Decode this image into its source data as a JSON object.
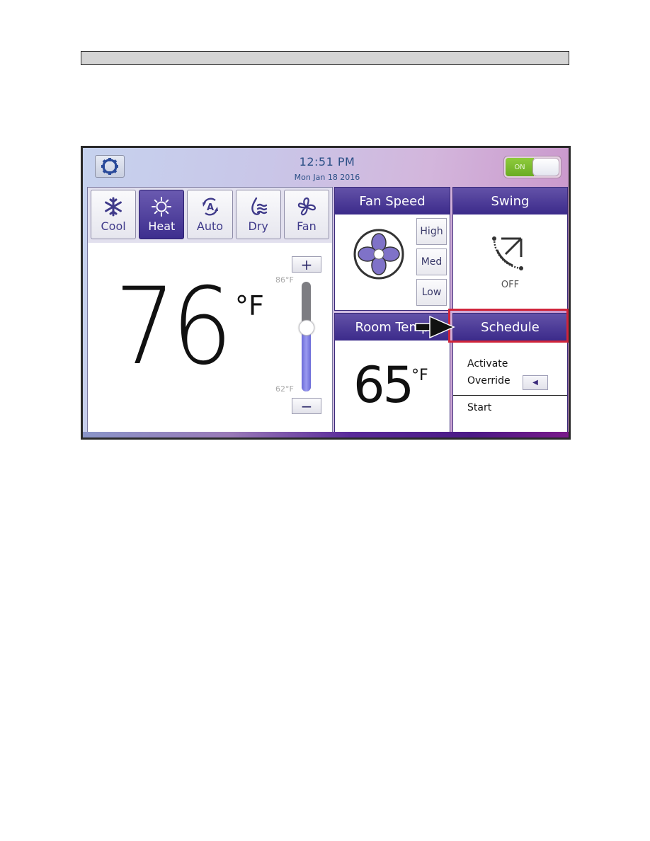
{
  "document": {
    "header_bar_text": ""
  },
  "status": {
    "time": "12:51 PM",
    "date": "Mon Jan 18 2016",
    "power_label": "ON",
    "power_on": true
  },
  "icons": {
    "settings": "gear-icon",
    "cool": "snowflake-icon",
    "heat": "sun-icon",
    "auto": "auto-cycle-icon",
    "dry": "droplet-waves-icon",
    "fan": "fan-icon",
    "swing": "swing-arc-arrow-icon",
    "override": "triangle-left-icon",
    "pointer": "arrow-right-icon"
  },
  "modes": [
    {
      "label": "Cool",
      "active": false
    },
    {
      "label": "Heat",
      "active": true
    },
    {
      "label": "Auto",
      "active": false
    },
    {
      "label": "Dry",
      "active": false
    },
    {
      "label": "Fan",
      "active": false
    }
  ],
  "setpoint": {
    "value": "76",
    "unit": "°F",
    "max_label": "86°F",
    "min_label": "62°F",
    "min": 62,
    "max": 86,
    "current": 76,
    "increase_label": "+",
    "decrease_label": "−"
  },
  "fan_speed": {
    "title": "Fan Speed",
    "options": [
      "High",
      "Med",
      "Low"
    ]
  },
  "swing": {
    "title": "Swing",
    "status": "OFF"
  },
  "room_temp": {
    "title": "Room Temp",
    "value": "65",
    "unit": "°F"
  },
  "schedule": {
    "title": "Schedule",
    "activate_label": "Activate",
    "override_label": "Override",
    "override_button": "◀",
    "start_label": "Start",
    "highlighted": true
  },
  "colors": {
    "accent": "#3d2e8e",
    "highlight": "#d0243a",
    "power_on": "#7cbd2f",
    "clock_text": "#2b4f86"
  }
}
